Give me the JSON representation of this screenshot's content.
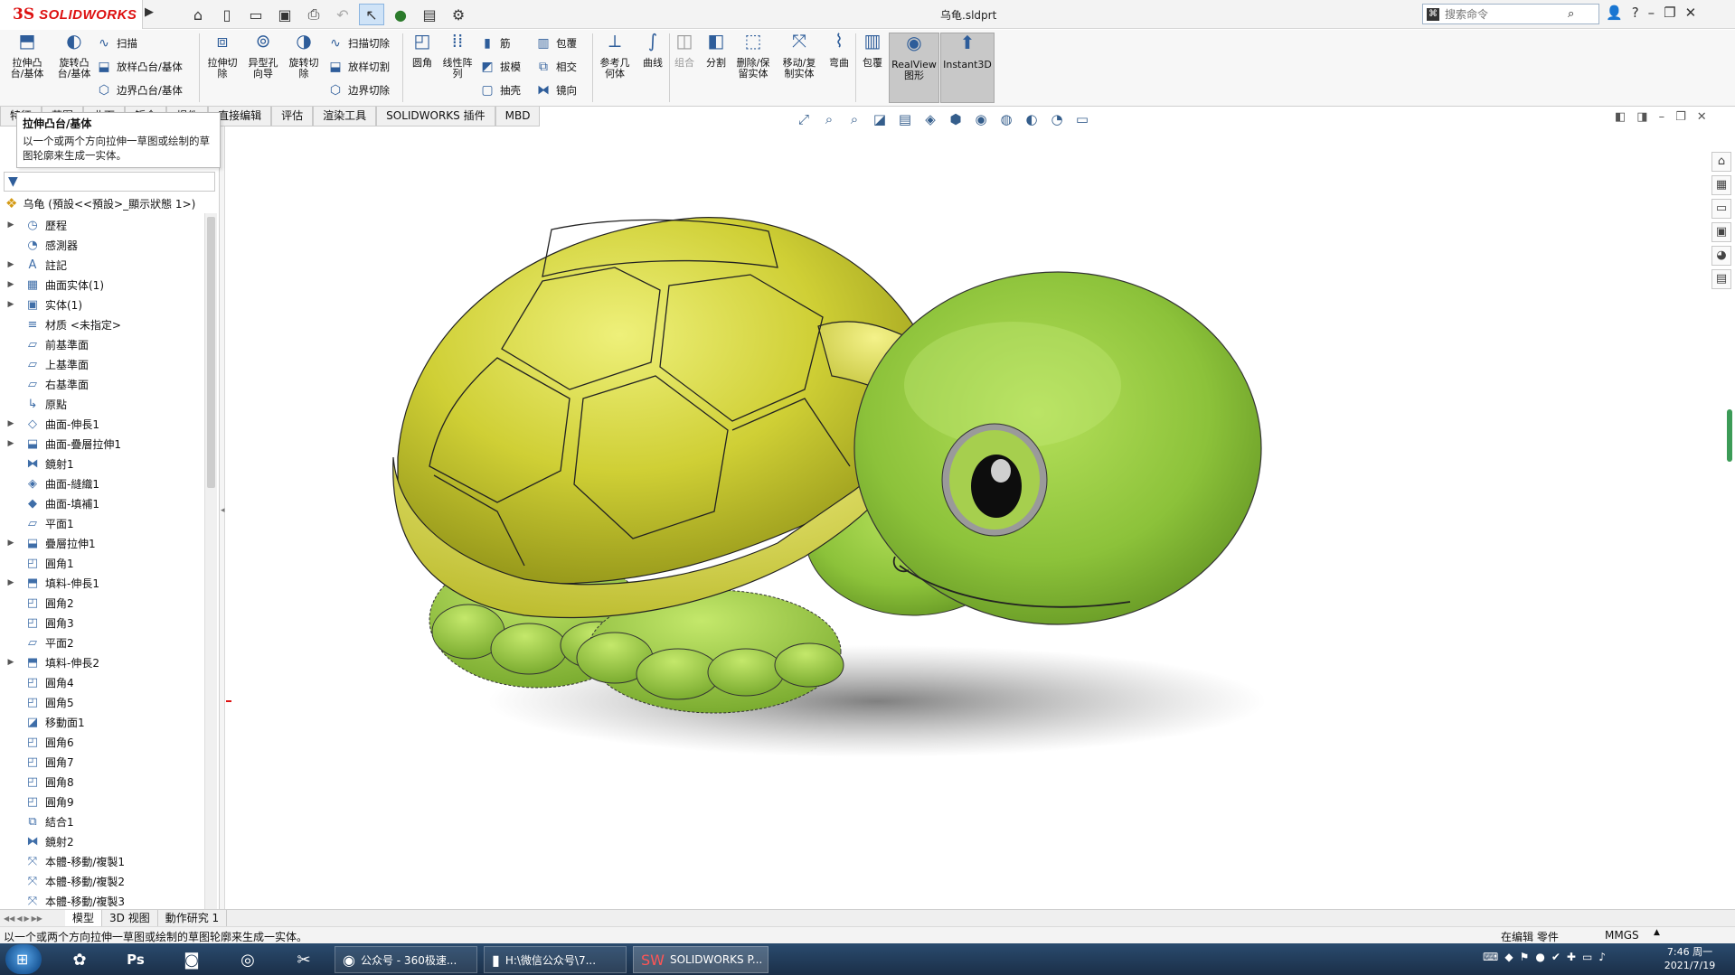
{
  "app": {
    "logo_ds": "3S",
    "logo_text": "SOLIDWORKS",
    "doc_title": "乌龟.sldprt",
    "search_placeholder": "搜索命令"
  },
  "ribbon": {
    "extrude_boss": "拉伸凸\n台/基体",
    "revolve_boss": "旋转凸\n台/基体",
    "sweep": "扫描",
    "loft": "放样凸台/基体",
    "boundary": "边界凸台/基体",
    "extrude_cut": "拉伸切\n除",
    "hole_wizard": "异型孔\n向导",
    "revolve_cut": "旋转切\n除",
    "sweep_cut": "扫描切除",
    "loft_cut": "放样切割",
    "boundary_cut": "边界切除",
    "fillet": "圆角",
    "linear_pattern": "线性阵\n列",
    "rib": "筋",
    "draft": "拔模",
    "shell": "抽壳",
    "wrap": "包覆",
    "intersect": "相交",
    "mirror": "镜向",
    "ref_geometry": "参考几\n何体",
    "curves": "曲线",
    "combine": "组合",
    "split": "分割",
    "delete_keep_body": "删除/保\n留实体",
    "move_copy_body": "移动/复\n制实体",
    "flex": "弯曲",
    "wrap2": "包覆",
    "realview": "RealView\n图形",
    "instant3d": "Instant3D"
  },
  "tabs": [
    "特征",
    "草图",
    "曲面",
    "钣金",
    "焊件",
    "直接编辑",
    "评估",
    "渲染工具",
    "SOLIDWORKS 插件",
    "MBD"
  ],
  "tooltip": {
    "title": "拉伸凸台/基体",
    "body": "以一个或两个方向拉伸一草图或绘制的草图轮廓来生成一实体。"
  },
  "feature_tree": {
    "root": "乌龟 (預設<<預設>_顯示狀態 1>)",
    "items": [
      {
        "label": "歷程",
        "icon": "history-icon",
        "exp": true
      },
      {
        "label": "感測器",
        "icon": "sensor-icon",
        "exp": false
      },
      {
        "label": "註記",
        "icon": "annotation-icon",
        "exp": true
      },
      {
        "label": "曲面实体(1)",
        "icon": "surface-body-icon",
        "exp": true
      },
      {
        "label": "实体(1)",
        "icon": "solid-body-icon",
        "exp": true
      },
      {
        "label": "材质 <未指定>",
        "icon": "material-icon",
        "exp": false
      },
      {
        "label": "前基準面",
        "icon": "plane-icon",
        "exp": false
      },
      {
        "label": "上基準面",
        "icon": "plane-icon",
        "exp": false
      },
      {
        "label": "右基準面",
        "icon": "plane-icon",
        "exp": false
      },
      {
        "label": "原點",
        "icon": "origin-icon",
        "exp": false
      },
      {
        "label": "曲面-伸長1",
        "icon": "surface-extrude-icon",
        "exp": true
      },
      {
        "label": "曲面-疊層拉伸1",
        "icon": "surface-loft-icon",
        "exp": true
      },
      {
        "label": "鏡射1",
        "icon": "mirror-icon",
        "exp": false
      },
      {
        "label": "曲面-縫織1",
        "icon": "knit-icon",
        "exp": false
      },
      {
        "label": "曲面-填補1",
        "icon": "fill-icon",
        "exp": false
      },
      {
        "label": "平面1",
        "icon": "plane-icon",
        "exp": false
      },
      {
        "label": "疊層拉伸1",
        "icon": "loft-icon",
        "exp": true
      },
      {
        "label": "圓角1",
        "icon": "fillet-icon",
        "exp": false
      },
      {
        "label": "填料-伸長1",
        "icon": "extrude-icon",
        "exp": true
      },
      {
        "label": "圓角2",
        "icon": "fillet-icon",
        "exp": false
      },
      {
        "label": "圓角3",
        "icon": "fillet-icon",
        "exp": false
      },
      {
        "label": "平面2",
        "icon": "plane-icon",
        "exp": false
      },
      {
        "label": "填料-伸長2",
        "icon": "extrude-icon",
        "exp": true
      },
      {
        "label": "圓角4",
        "icon": "fillet-icon",
        "exp": false
      },
      {
        "label": "圓角5",
        "icon": "fillet-icon",
        "exp": false
      },
      {
        "label": "移動面1",
        "icon": "move-face-icon",
        "exp": false
      },
      {
        "label": "圓角6",
        "icon": "fillet-icon",
        "exp": false
      },
      {
        "label": "圓角7",
        "icon": "fillet-icon",
        "exp": false
      },
      {
        "label": "圓角8",
        "icon": "fillet-icon",
        "exp": false
      },
      {
        "label": "圓角9",
        "icon": "fillet-icon",
        "exp": false
      },
      {
        "label": "結合1",
        "icon": "combine-icon",
        "exp": false
      },
      {
        "label": "鏡射2",
        "icon": "mirror-icon",
        "exp": false
      },
      {
        "label": "本體-移動/複製1",
        "icon": "move-body-icon",
        "exp": false
      },
      {
        "label": "本體-移動/複製2",
        "icon": "move-body-icon",
        "exp": false
      },
      {
        "label": "本體-移動/複製3",
        "icon": "move-body-icon",
        "exp": false
      }
    ]
  },
  "bottom_tabs": [
    "模型",
    "3D 视图",
    "動作研究 1"
  ],
  "status": {
    "message": "以一个或两个方向拉伸一草图或绘制的草图轮廓来生成一实体。",
    "edit_state": "在编辑 零件",
    "units": "MMGS"
  },
  "taskbar": {
    "windows": [
      {
        "label": "公众号 - 360极速...",
        "icon": "browser-icon"
      },
      {
        "label": "H:\\微信公众号\\7...",
        "icon": "folder-icon"
      },
      {
        "label": "SOLIDWORKS P...",
        "icon": "solidworks-icon"
      }
    ],
    "time": "7:46 周一",
    "date": "2021/7/19"
  },
  "colors": {
    "shell": "#cfcf35",
    "body": "#8fc33a",
    "ribbon_bg": "#f7f7f7",
    "brand": "#dd1111"
  }
}
